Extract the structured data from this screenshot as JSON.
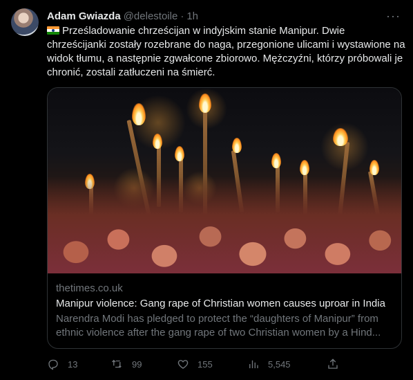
{
  "tweet": {
    "author_name": "Adam Gwiazda",
    "handle": "@delestoile",
    "separator": "·",
    "time": "1h",
    "more_label": "···",
    "text": "Prześladowanie chrześcijan w indyjskim stanie Manipur. Dwie chrześcijanki zostały rozebrane do naga, przegonione ulicami i wystawione na widok tłumu, a następnie zgwałcone zbiorowo. Mężczyźni, którzy próbowali je chronić, zostali zatłuczeni na śmierć."
  },
  "card": {
    "domain": "thetimes.co.uk",
    "title": "Manipur violence: Gang rape of Christian women causes uproar in India",
    "description": "Narendra Modi has pledged to protect the “daughters of Manipur” from ethnic violence after the gang rape of two Christian women by a Hind..."
  },
  "actions": {
    "replies": "13",
    "retweets": "99",
    "likes": "155",
    "views": "5,545"
  },
  "colors": {
    "background": "#000000",
    "text": "#e7e9ea",
    "secondary": "#71767b",
    "border": "#2f3336"
  },
  "icons": [
    "reply-icon",
    "retweet-icon",
    "like-icon",
    "views-icon",
    "share-icon",
    "more-icon",
    "india-flag-icon"
  ]
}
